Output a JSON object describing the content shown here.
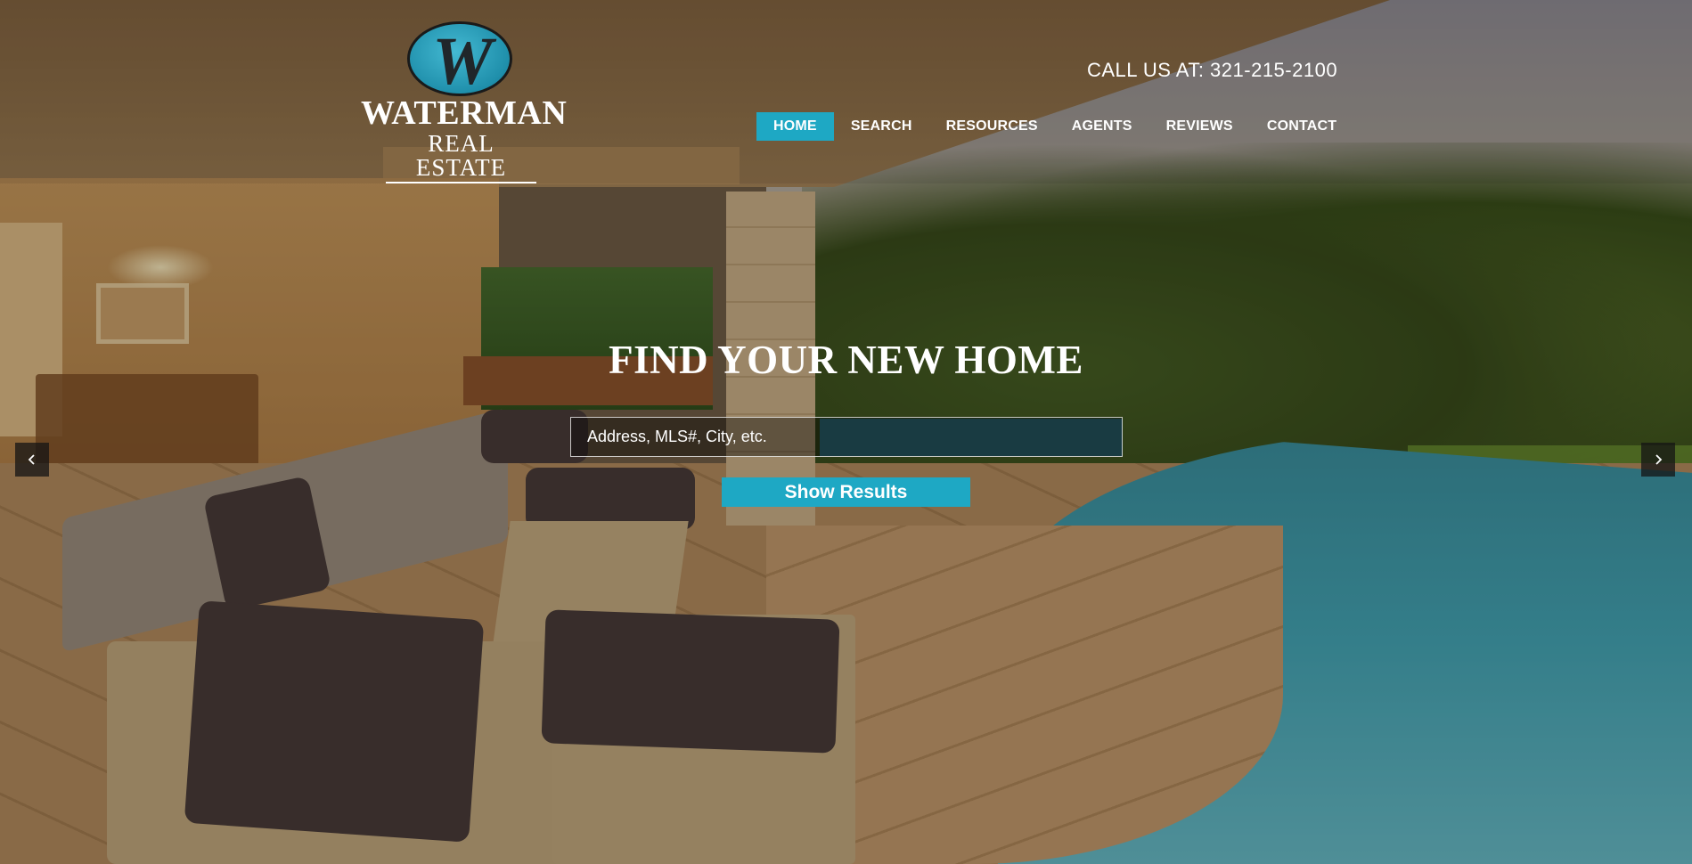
{
  "brand": {
    "logo_letter": "W",
    "name": "WATERMAN",
    "tagline": "REAL ESTATE"
  },
  "header": {
    "phone": "CALL US AT: 321-215-2100"
  },
  "nav": {
    "items": [
      {
        "label": "HOME",
        "active": true
      },
      {
        "label": "SEARCH"
      },
      {
        "label": "RESOURCES"
      },
      {
        "label": "AGENTS"
      },
      {
        "label": "REVIEWS"
      },
      {
        "label": "CONTACT"
      }
    ]
  },
  "hero": {
    "headline": "FIND YOUR NEW HOME",
    "search_placeholder": "Address, MLS#, City, etc.",
    "button_label": "Show Results",
    "prev_icon": "chevron-left-icon",
    "next_icon": "chevron-right-icon"
  },
  "colors": {
    "accent": "#1ea8c4",
    "text": "#ffffff"
  }
}
